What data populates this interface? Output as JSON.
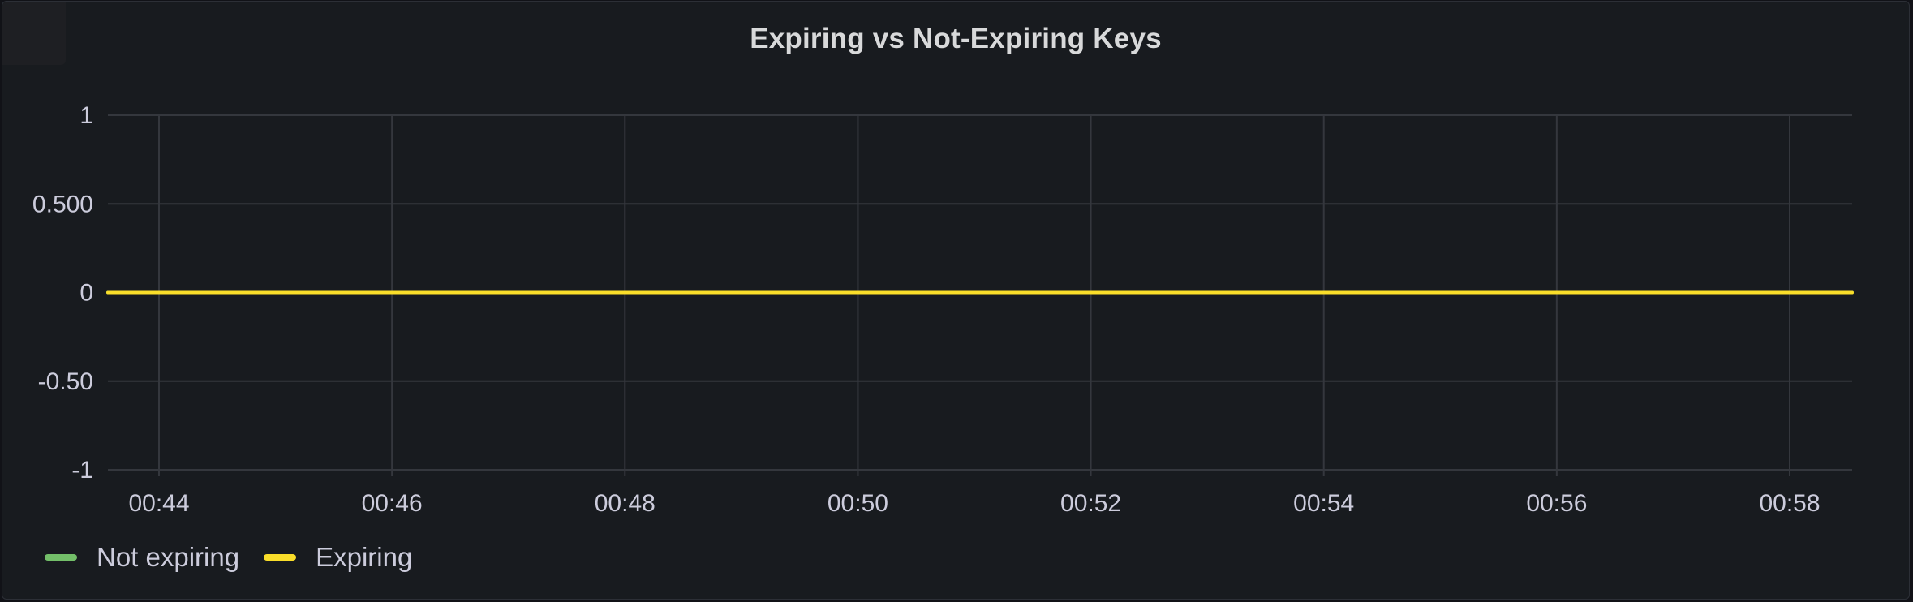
{
  "panel": {
    "title": "Expiring vs Not-Expiring Keys"
  },
  "chart_data": {
    "type": "line",
    "title": "Expiring vs Not-Expiring Keys",
    "x": [
      "00:44",
      "00:46",
      "00:48",
      "00:50",
      "00:52",
      "00:54",
      "00:56",
      "00:58"
    ],
    "x_tick_labels": [
      "00:44",
      "00:46",
      "00:48",
      "00:50",
      "00:52",
      "00:54",
      "00:56",
      "00:58"
    ],
    "y_tick_labels": [
      "1",
      "0.500",
      "0",
      "-0.50",
      "-1"
    ],
    "y_ticks": [
      1,
      0.5,
      0,
      -0.5,
      -1
    ],
    "ylim": [
      -1,
      1
    ],
    "grid": true,
    "legend": "bottom-left",
    "series": [
      {
        "name": "Not expiring",
        "color": "#73bf69",
        "values": [
          0,
          0,
          0,
          0,
          0,
          0,
          0,
          0
        ]
      },
      {
        "name": "Expiring",
        "color": "#fade2a",
        "values": [
          0,
          0,
          0,
          0,
          0,
          0,
          0,
          0
        ]
      }
    ]
  }
}
